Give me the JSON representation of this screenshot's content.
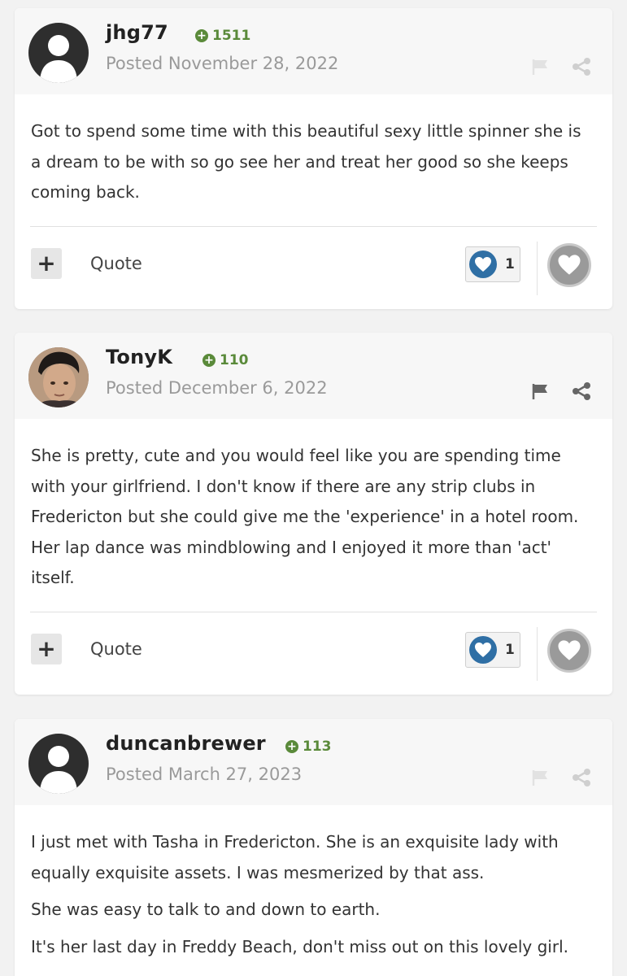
{
  "colors": {
    "reputation": "#5a8a3a",
    "like_heart": "#2f6fa5",
    "muted_text": "#9a9a9a"
  },
  "posts": [
    {
      "author": "jhg77",
      "reputation": "1511",
      "posted": "Posted November 28, 2022",
      "avatar": "default-avatar",
      "paragraphs": [
        "Got to spend some time with this beautiful sexy little spinner she is a dream  to be with so go see her and treat her good so she keeps coming back."
      ],
      "quote_label": "Quote",
      "like_count": "1"
    },
    {
      "author": "TonyK",
      "reputation": "110",
      "posted": "Posted December 6, 2022",
      "avatar": "photo-avatar",
      "paragraphs": [
        "She is pretty, cute and you would feel like you are spending time with your girlfriend. I don't know if there are any strip clubs in Fredericton but she could give me the 'experience' in a hotel room. Her lap dance was mindblowing and I enjoyed it more than 'act' itself."
      ],
      "quote_label": "Quote",
      "like_count": "1"
    },
    {
      "author": "duncanbrewer",
      "reputation": "113",
      "posted": "Posted March 27, 2023",
      "avatar": "default-avatar",
      "paragraphs": [
        "I just met with Tasha in Fredericton. She is an exquisite lady with equally exquisite assets. I was mesmerized by that ass.",
        "She was easy to talk to and down to earth.",
        "It's her last day in Freddy Beach, don't miss out on this lovely girl."
      ]
    }
  ]
}
